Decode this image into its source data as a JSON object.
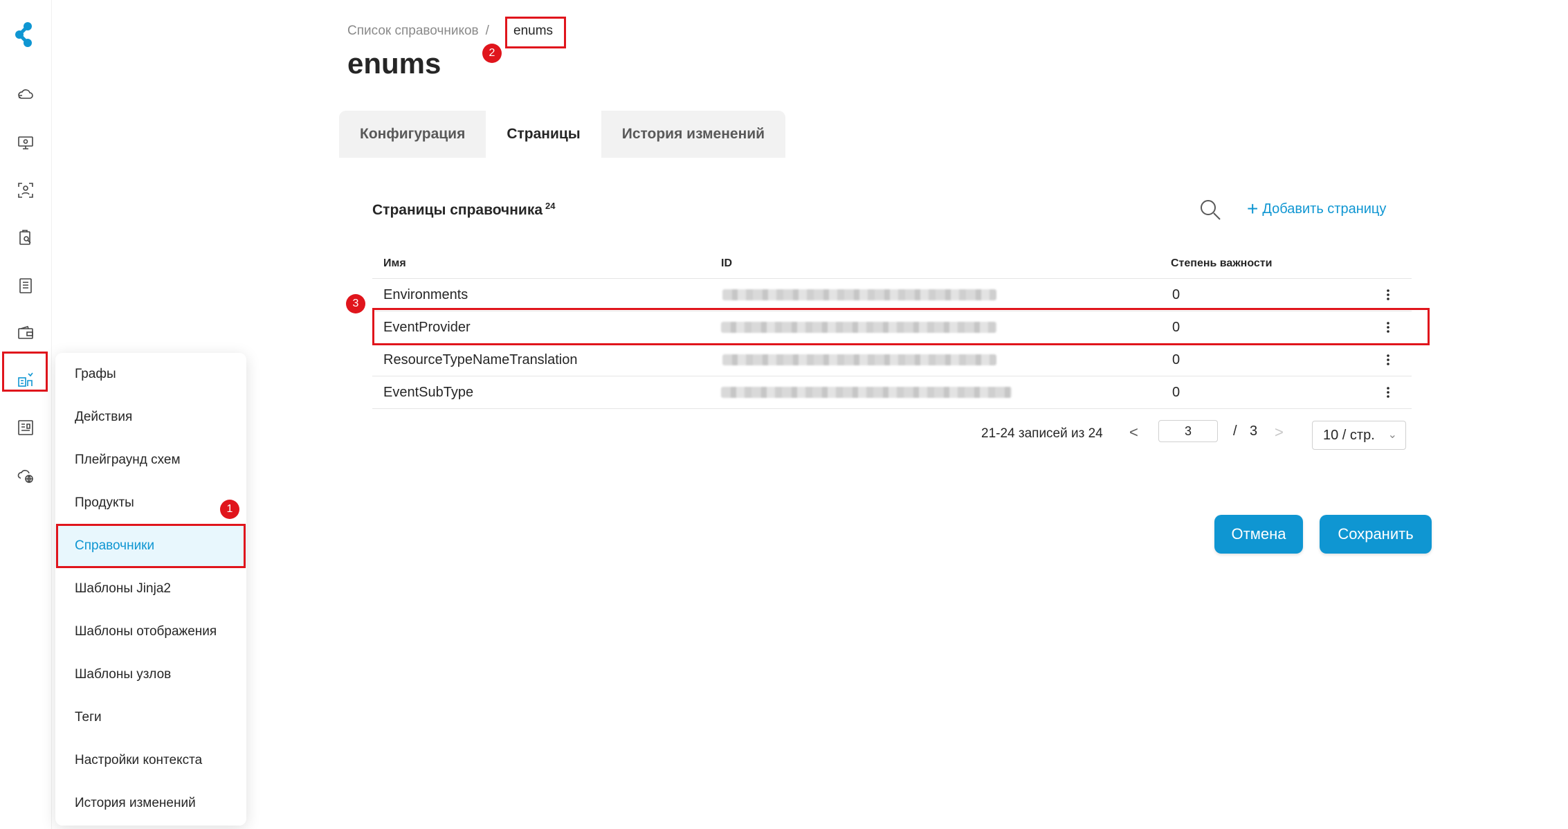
{
  "breadcrumb": {
    "parent": "Список справочников",
    "separator": "/",
    "current": "enums"
  },
  "page_title": "enums",
  "tabs": [
    {
      "label": "Конфигурация",
      "active": false
    },
    {
      "label": "Страницы",
      "active": true
    },
    {
      "label": "История изменений",
      "active": false
    }
  ],
  "section": {
    "title": "Страницы справочника",
    "count": "24",
    "add_label": "Добавить страницу"
  },
  "table": {
    "columns": [
      "Имя",
      "ID",
      "Степень важности"
    ],
    "rows": [
      {
        "name": "Environments",
        "importance": "0"
      },
      {
        "name": "EventProvider",
        "importance": "0"
      },
      {
        "name": "ResourceTypeNameTranslation",
        "importance": "0"
      },
      {
        "name": "EventSubType",
        "importance": "0"
      }
    ]
  },
  "pagination": {
    "summary": "21-24 записей из 24",
    "current_page": "3",
    "separator": "/",
    "total_pages": "3",
    "page_size": "10 / стр.",
    "prev": "<",
    "next": ">"
  },
  "actions": {
    "cancel": "Отмена",
    "save": "Сохранить"
  },
  "submenu": [
    "Графы",
    "Действия",
    "Плейграунд схем",
    "Продукты",
    "Справочники",
    "Шаблоны Jinja2",
    "Шаблоны отображения",
    "Шаблоны узлов",
    "Теги",
    "Настройки контекста",
    "История изменений"
  ],
  "submenu_active": "Справочники",
  "markers": [
    "1",
    "2",
    "3"
  ],
  "colors": {
    "accent": "#0f96d2",
    "highlight": "#e0151c",
    "active_bg": "#e8f7fd"
  },
  "rail_icons": [
    "cloud-icon",
    "monitor-settings-icon",
    "scan-person-icon",
    "clipboard-search-icon",
    "list-document-icon",
    "wallet-icon",
    "chart-building-icon",
    "dashboard-icon",
    "cloud-globe-icon"
  ]
}
